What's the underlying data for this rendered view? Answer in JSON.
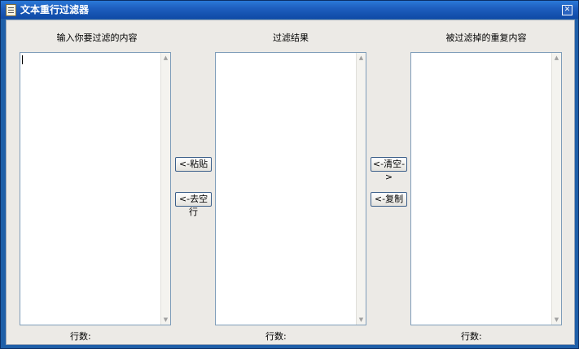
{
  "window": {
    "title": "文本重行过滤器",
    "close_glyph": "✕"
  },
  "columns": {
    "input_label": "输入你要过滤的内容",
    "result_label": "过滤结果",
    "removed_label": "被过滤掉的重复内容"
  },
  "buttons": {
    "paste": "<-粘贴",
    "remove_blank": "<-去空行",
    "clear": "<-清空->",
    "copy": "<-复制"
  },
  "footer": {
    "rows_label": "行数:"
  },
  "scroll": {
    "up_arrow": "▲",
    "down_arrow": "▼"
  },
  "icons": [
    "app-icon",
    "close-icon",
    "scroll-up-arrow-icon",
    "scroll-down-arrow-icon"
  ],
  "colors": {
    "title_bar": "#1e5fbf",
    "client_bg": "#eceae6",
    "textbox_border": "#7f9db9"
  }
}
